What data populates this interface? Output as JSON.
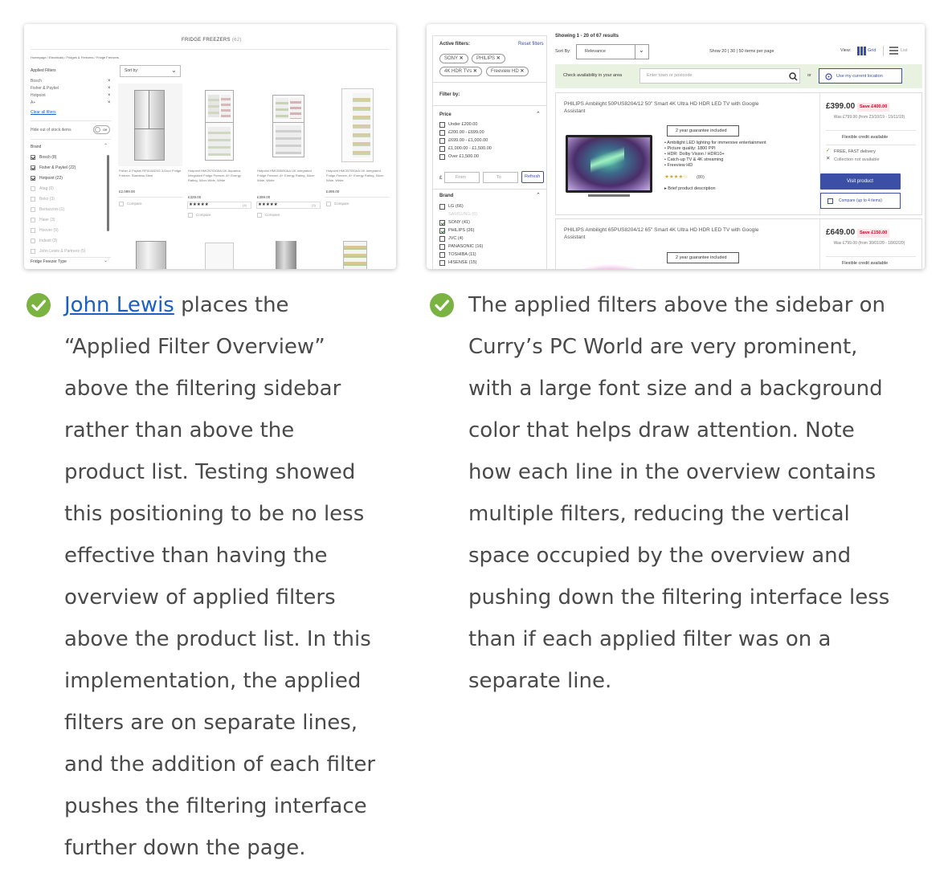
{
  "left_screenshot": {
    "page_title": "FRIDGE FREEZERS",
    "count": "(62)",
    "breadcrumb": "Homepage  /  Electricals  /  Fridges & Freezers  /  Fridge Freezers",
    "applied_filters_heading": "Applied Filters",
    "applied_filters": [
      "Bosch",
      "Fisher & Paykel",
      "Hotpoint",
      "A+"
    ],
    "clear_all": "Clear all filters",
    "hide_out_of_stock": "Hide out of stock items",
    "toggle": "Off",
    "sort_label": "Sort by:",
    "brand_heading": "Brand",
    "brands": [
      {
        "label": "Bosch (8)",
        "checked": true
      },
      {
        "label": "Fisher & Paykel (22)",
        "checked": true
      },
      {
        "label": "Hotpoint (22)",
        "checked": true
      },
      {
        "label": "Atag (0)",
        "checked": false
      },
      {
        "label": "Beko (3)",
        "checked": false
      },
      {
        "label": "Bertazzoni (1)",
        "checked": false
      },
      {
        "label": "Haier (3)",
        "checked": false
      },
      {
        "label": "Hoover (9)",
        "checked": false
      },
      {
        "label": "Indesit (3)",
        "checked": false
      },
      {
        "label": "John Lewis & Partners (5)",
        "checked": false
      }
    ],
    "type_heading": "Fridge Freezer Type",
    "products": [
      {
        "name": "Fisher & Paykel RF610ADX5 3-Door Fridge Freezer, Stainless Steel",
        "price": "£2,099.00",
        "compare": "Compare"
      },
      {
        "name": "Hotpoint HMCB7030AA.UK Aquarius Integrated Fridge Freezer, A+ Energy Rating, 54cm Wide, White",
        "price": "£329.00",
        "stars": "★★★★★",
        "reviews": "(4)",
        "compare": "Compare"
      },
      {
        "name": "Hotpoint HMCB5050AA.UK Integrated Fridge Freezer, A+ Energy Rating, 54cm Wide, White",
        "price": "£399.00",
        "stars": "★★★★★",
        "reviews": "(3)",
        "compare": "Compare"
      },
      {
        "name": "Hotpoint HMCB7050AA.UK Integrated Fridge Freezer, A+ Energy Rating, 54cm Wide, White",
        "price": "£499.00",
        "compare": "Compare"
      }
    ]
  },
  "right_screenshot": {
    "active_filters_label": "Active filters:",
    "reset_filters": "Reset filters",
    "chips": [
      "SONY",
      "PHILIPS",
      "4K HDR TVs",
      "Freeview HD"
    ],
    "chip_close": "✕",
    "filter_by": "Filter by:",
    "price_heading": "Price",
    "price_options": [
      "Under £200.00",
      "£200.00 - £699.00",
      "£699.00 - £1,000.00",
      "£1,000.00 - £1,500.00",
      "Over £1,500.00"
    ],
    "price_symbol": "£",
    "from_placeholder": "From",
    "to_placeholder": "To",
    "refresh": "Refresh",
    "brand_heading": "Brand",
    "brands": [
      {
        "label": "LG (66)",
        "checked": false
      },
      {
        "label": "SAMSUNG (0)",
        "checked": false,
        "disabled": true
      },
      {
        "label": "SONY (41)",
        "checked": true
      },
      {
        "label": "PHILIPS (26)",
        "checked": true
      },
      {
        "label": "JVC (4)",
        "checked": false
      },
      {
        "label": "PANASONIC (16)",
        "checked": false
      },
      {
        "label": "TOSHIBA (11)",
        "checked": false
      },
      {
        "label": "HISENSE (15)",
        "checked": false
      }
    ],
    "showing": "Showing 1 - 20 of 67 results",
    "sort_label": "Sort By:",
    "sort_value": "Relevance",
    "per_page": "Show 20 | 30 | 50 items per page",
    "view_label": "View:",
    "view_grid": "Grid",
    "view_list": "List",
    "availability_label": "Check availability in your area",
    "postcode_placeholder": "Enter town or postcode",
    "or": "or",
    "use_location": "Use my current location",
    "products": [
      {
        "title": "PHILIPS Ambilight 50PUS8204/12 50\" Smart 4K Ultra HD HDR LED TV with Google Assistant",
        "guarantee": "2 year guarantee included",
        "features": [
          "Ambilight LED lighting for immersive entertainment",
          "Picture quality: 1800 PPI",
          "HDR: Dolby Vision / HDR10+",
          "Catch-up TV & 4K streaming",
          "Freeview HD"
        ],
        "stars": "★★★★☆",
        "reviews": "(80)",
        "description": "Brief product description",
        "price": "£399.00",
        "save": "Save £400.00",
        "was": "Was £799.00 (from 23/10/19 - 15/11/19)",
        "credit": "Flexible credit available",
        "delivery": "FREE, FAST delivery",
        "collection": "Collection not available",
        "visit": "Visit product",
        "compare": "Compare (up to 4 items)"
      },
      {
        "title": "PHILIPS Ambilight 65PUS8204/12 65\" Smart 4K Ultra HD HDR LED TV with Google Assistant",
        "guarantee": "2 year guarantee included",
        "price": "£649.00",
        "save": "Save £150.00",
        "was": "Was £799.00 (from 30/01/20 - 18/02/20)",
        "credit": "Flexible credit available"
      }
    ]
  },
  "captions": {
    "left_link": "John Lewis",
    "left_lines": [
      " places the",
      "“Applied Filter Overview”",
      "above the filtering sidebar",
      "rather than above the",
      "product list. Testing showed",
      "this positioning to be no less",
      "effective than having the",
      "overview of applied filters",
      "above the product list. In this",
      "implementation, the applied",
      "filters are on separate lines,",
      "and the addition of each filter",
      "pushes the filtering interface",
      "further down the page."
    ],
    "right_lines": [
      "The applied filters above the sidebar on",
      "Curry’s PC World are very prominent,",
      "with a large font size and a background",
      "color that helps draw attention. Note",
      "how each line in the overview contains",
      "multiple filters, reducing the vertical",
      "space occupied by the overview and",
      "pushing down the filtering interface less",
      "than if each applied filter was on a",
      "separate line."
    ]
  },
  "colors": {
    "check_green": "#7bb342",
    "link_blue": "#1a5fc4",
    "currys_blue": "#3b4fa6",
    "save_red": "#d2002b"
  }
}
